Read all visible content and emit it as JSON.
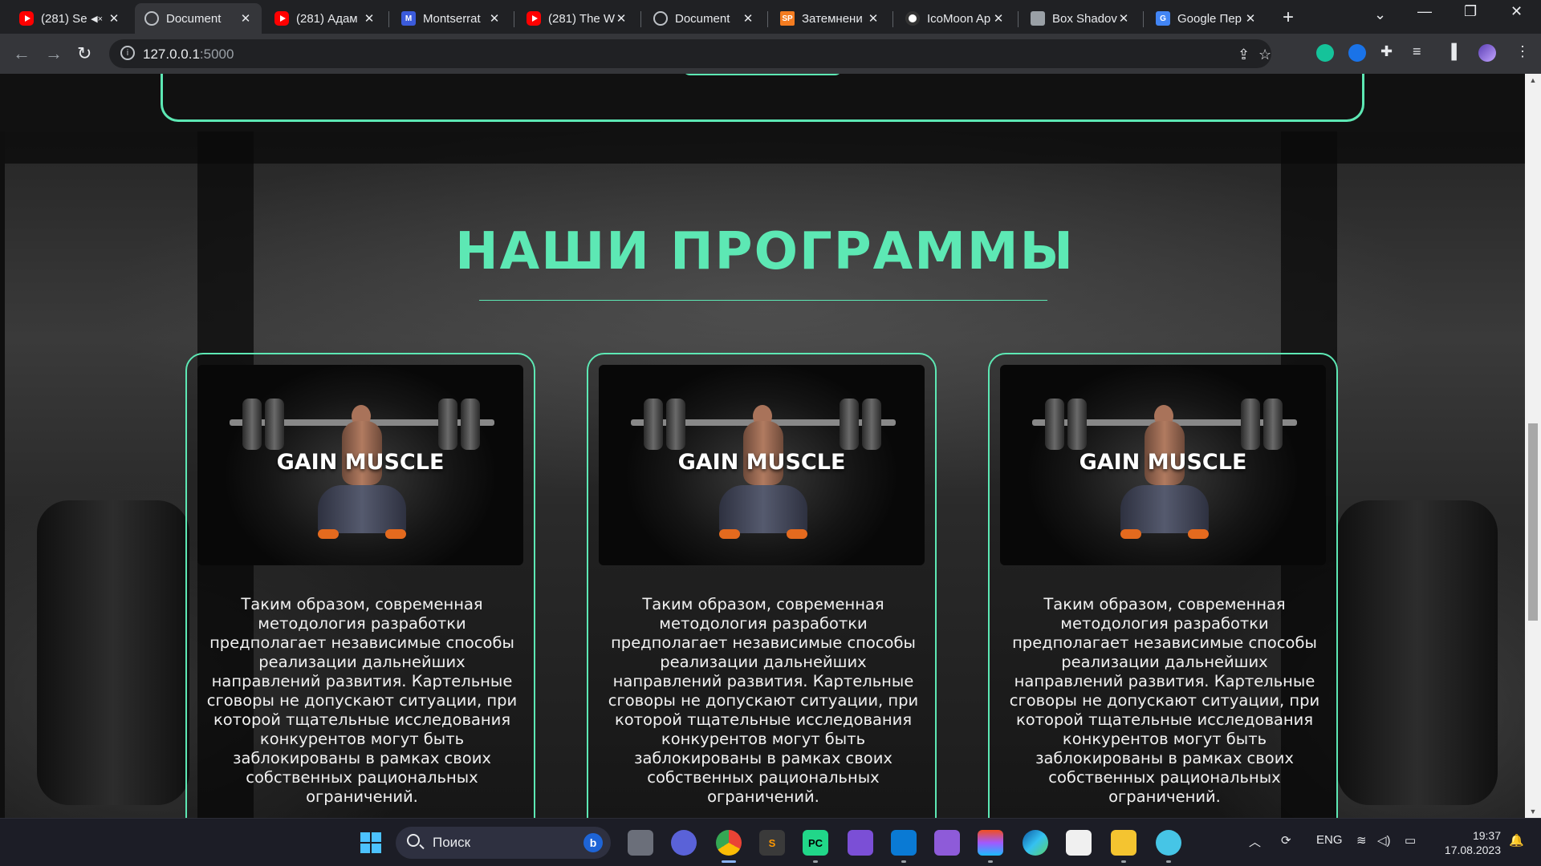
{
  "browser": {
    "tabs": [
      {
        "title": "(281) Se",
        "icon": "youtube-icon",
        "muted": true,
        "active": false
      },
      {
        "title": "Document",
        "icon": "globe-icon",
        "active": true
      },
      {
        "title": "(281) Адам",
        "icon": "youtube-icon",
        "active": false
      },
      {
        "title": "Montserrat",
        "icon": "font-site-icon",
        "icon_text": "M",
        "active": false
      },
      {
        "title": "(281) The W",
        "icon": "youtube-icon",
        "active": false
      },
      {
        "title": "Document",
        "icon": "globe-icon",
        "active": false
      },
      {
        "title": "Затемнени",
        "icon": "sp-icon",
        "icon_text": "SP",
        "active": false
      },
      {
        "title": "IcoMoon Ap",
        "icon": "icomoon-icon",
        "active": false
      },
      {
        "title": "Box Shadov",
        "icon": "box-icon",
        "active": false
      },
      {
        "title": "Google Пер",
        "icon": "google-translate-icon",
        "icon_text": "G",
        "active": false
      }
    ],
    "close_glyph": "✕",
    "new_tab_glyph": "+",
    "url_host": "127.0.0.1",
    "url_port": ":5000"
  },
  "page": {
    "section_title": "НАШИ ПРОГРАММЫ",
    "accent_color": "#5de8b4",
    "cards": [
      {
        "title": "GAIN MUSCLE",
        "text": "Таким образом, современная методология разработки предполагает независимые способы реализации дальнейших направлений развития. Картельные сговоры не допускают ситуации, при которой тщательные исследования конкурентов могут быть заблокированы в рамках своих собственных рациональных ограничений."
      },
      {
        "title": "GAIN MUSCLE",
        "text": "Таким образом, современная методология разработки предполагает независимые способы реализации дальнейших направлений развития. Картельные сговоры не допускают ситуации, при которой тщательные исследования конкурентов могут быть заблокированы в рамках своих собственных рациональных ограничений."
      },
      {
        "title": "GAIN MUSCLE",
        "text": "Таким образом, современная методология разработки предполагает независимые способы реализации дальнейших направлений развития. Картельные сговоры не допускают ситуации, при которой тщательные исследования конкурентов могут быть заблокированы в рамках своих собственных рациональных ограничений."
      }
    ]
  },
  "taskbar": {
    "search_label": "Поиск",
    "language": "ENG",
    "time": "19:37",
    "date": "17.08.2023"
  }
}
